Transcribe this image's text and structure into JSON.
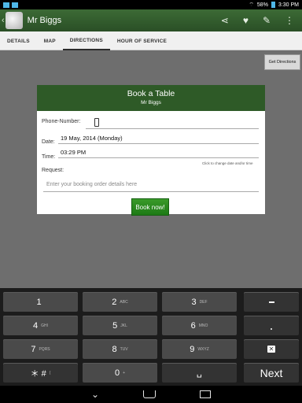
{
  "statusbar": {
    "battery": "58%",
    "time": "3:30 PM"
  },
  "actionbar": {
    "title": "Mr Biggs",
    "back": "‹"
  },
  "tabs": [
    {
      "label": "DETAILS"
    },
    {
      "label": "MAP"
    },
    {
      "label": "DIRECTIONS"
    },
    {
      "label": "HOUR OF SERVICE"
    }
  ],
  "directions_button": "Get Directions",
  "dialog": {
    "title": "Book a Table",
    "subtitle": "Mr Biggs",
    "phone_label": "Phone-Number:",
    "date_label": "Date:",
    "date_value": "19 May, 2014 (Monday)",
    "time_label": "Time:",
    "time_value": "03:29 PM",
    "hint": "Click to change date and/or time",
    "request_label": "Request:",
    "request_placeholder": "Enter your booking order details here",
    "book_button": "Book now!"
  },
  "keyboard": {
    "keys": [
      {
        "num": "1",
        "letters": ""
      },
      {
        "num": "2",
        "letters": "ABC"
      },
      {
        "num": "3",
        "letters": "DEF"
      },
      {
        "num": "4",
        "letters": "GHI"
      },
      {
        "num": "5",
        "letters": "JKL"
      },
      {
        "num": "6",
        "letters": "MNO"
      },
      {
        "num": "7",
        "letters": "PQRS"
      },
      {
        "num": "8",
        "letters": "TUV"
      },
      {
        "num": "9",
        "letters": "WXYZ"
      },
      {
        "num": "＊ #",
        "letters": "("
      },
      {
        "num": "0",
        "letters": "+"
      },
      {
        "num": "␣",
        "letters": ""
      }
    ],
    "next": "Next"
  },
  "colors": {
    "actionbar": "#2e5a27",
    "button": "#1d7a15"
  }
}
